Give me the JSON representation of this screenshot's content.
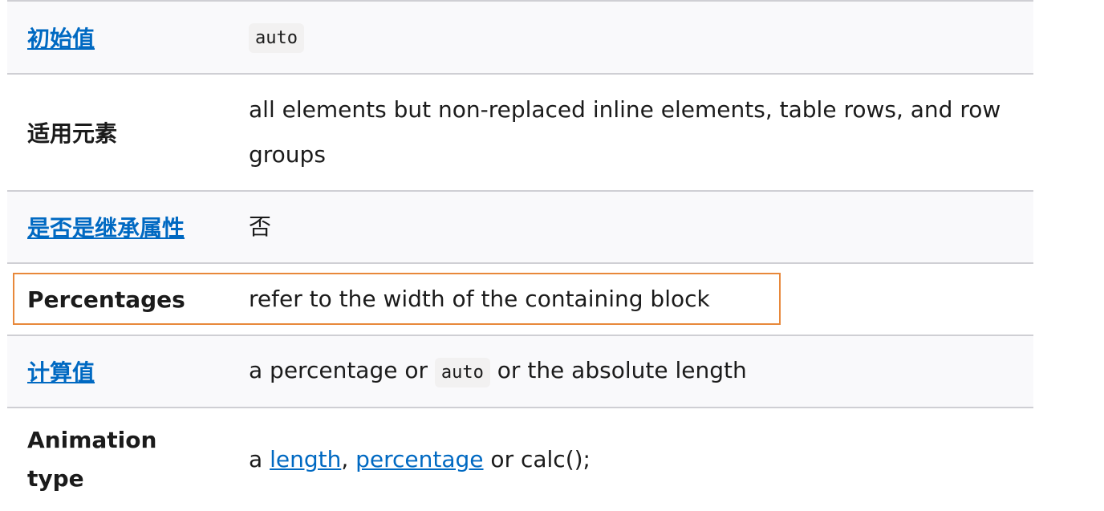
{
  "rows": [
    {
      "header": "初始值",
      "header_link": true,
      "value_code": "auto"
    },
    {
      "header": "适用元素",
      "header_link": false,
      "value": "all elements but non-replaced inline elements, table rows, and row groups"
    },
    {
      "header": "是否是继承属性",
      "header_link": true,
      "value": "否"
    },
    {
      "header": "Percentages",
      "header_link": false,
      "value": "refer to the width of the containing block"
    },
    {
      "header": "计算值",
      "header_link": true,
      "value_before": "a percentage or ",
      "value_code": "auto",
      "value_after": " or the absolute length"
    },
    {
      "header": "Animation type",
      "header_link": false,
      "value_prefix": "a ",
      "link1": "length",
      "separator": ", ",
      "link2": "percentage",
      "value_suffix": " or calc();"
    }
  ],
  "colors": {
    "link": "#0069c2",
    "row_shade": "#f9f9fb",
    "border": "#cfcfd4",
    "highlight": "#e8883a"
  }
}
